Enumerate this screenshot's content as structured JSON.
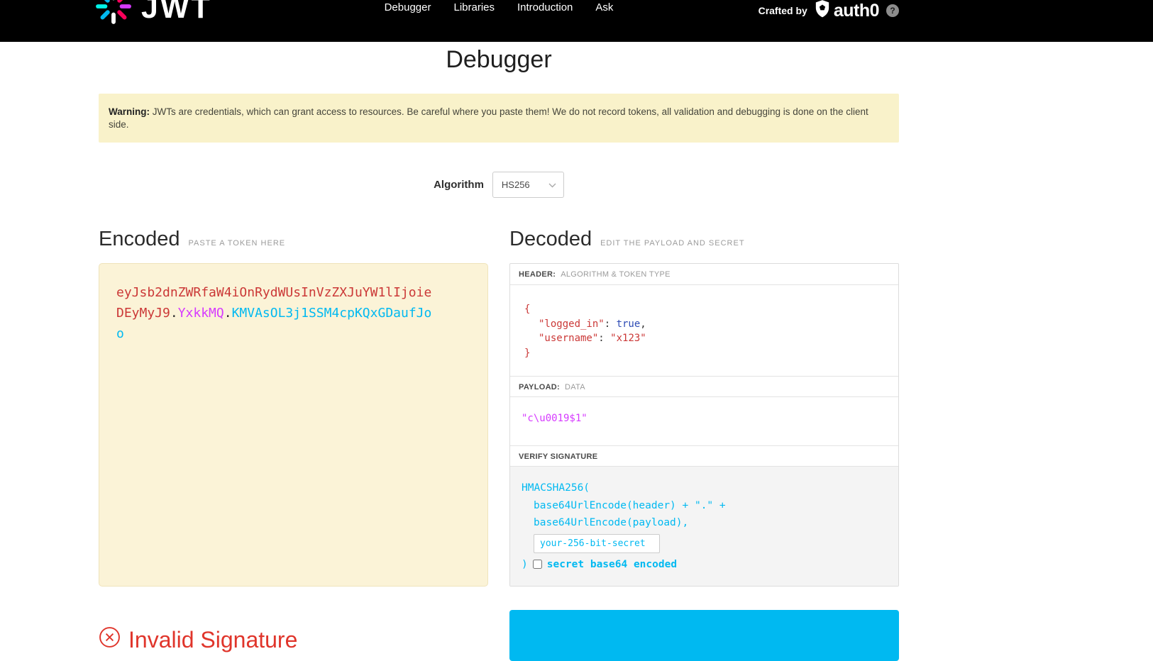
{
  "navbar": {
    "logo_text": "JWT",
    "links": [
      {
        "label": "Debugger"
      },
      {
        "label": "Libraries"
      },
      {
        "label": "Introduction"
      },
      {
        "label": "Ask"
      }
    ],
    "crafted_by": "Crafted by",
    "brand": "auth0",
    "help": "?"
  },
  "page": {
    "title": "Debugger"
  },
  "warning": {
    "label": "Warning:",
    "text": " JWTs are credentials, which can grant access to resources. Be careful where you paste them! We do not record tokens, all validation and debugging is done on the client side."
  },
  "algorithm": {
    "label": "Algorithm",
    "value": "HS256"
  },
  "encoded": {
    "title": "Encoded",
    "subtitle": "PASTE A TOKEN HERE",
    "token": {
      "header": "eyJsb2dnZWRfaW4iOnRydWUsInVzZXJuYW1lIjoieDEyMyJ9",
      "dot1": ".",
      "payload": "YxkkMQ",
      "dot2": ".",
      "signature": "KMVAsOL3j1SSM4cpKQxGDaufJoo"
    }
  },
  "decoded": {
    "title": "Decoded",
    "subtitle": "EDIT THE PAYLOAD AND SECRET",
    "header_section": {
      "label": "HEADER:",
      "sublabel": "ALGORITHM & TOKEN TYPE",
      "json": {
        "open": "{",
        "key1": "\"logged_in\"",
        "sep1": ": ",
        "val1": "true",
        "comma1": ",",
        "key2": "\"username\"",
        "sep2": ": ",
        "val2": "\"x123\"",
        "close": "}"
      }
    },
    "payload_section": {
      "label": "PAYLOAD:",
      "sublabel": "DATA",
      "content": "\"c\\u0019$1\""
    },
    "signature_section": {
      "label": "VERIFY SIGNATURE",
      "line1": "HMACSHA256(",
      "line2": "base64UrlEncode(header) + \".\" +",
      "line3": "base64UrlEncode(payload),",
      "secret_value": "your-256-bit-secret",
      "close_paren": ")",
      "checkbox_label": "secret base64 encoded"
    }
  },
  "status": {
    "invalid_label": "Invalid Signature"
  },
  "colors": {
    "accent_cyan": "#00b9f1",
    "token_header_red": "#cb3837",
    "token_payload_purple": "#d63aff",
    "token_signature_cyan": "#00b9f1",
    "invalid_red": "#e0352b",
    "warning_bg": "#f9f2ca",
    "encoded_box_bg": "#fbf3d7",
    "navbar_bg": "#000000"
  }
}
